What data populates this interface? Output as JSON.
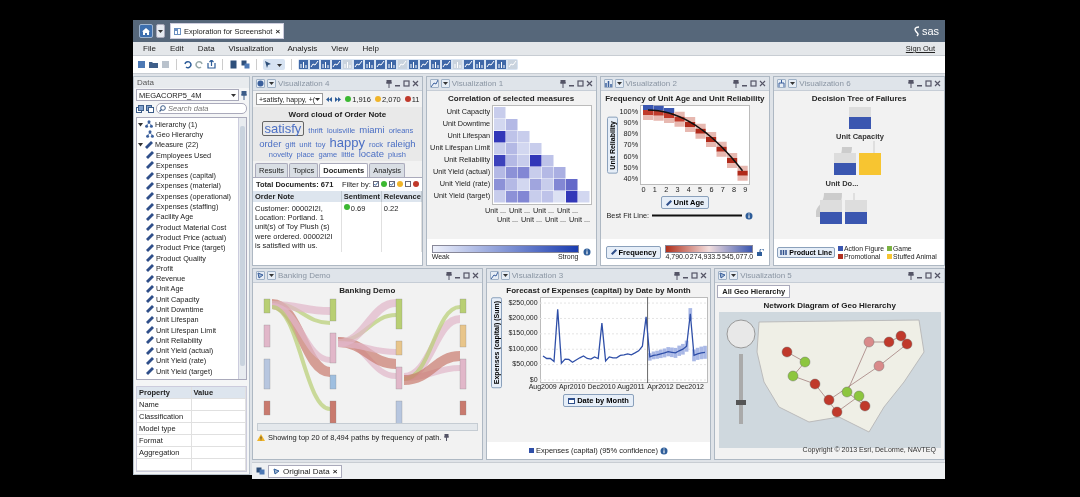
{
  "window": {
    "document_tab": "Exploration for Screenshot",
    "tab_close": "×",
    "logo": "sas"
  },
  "menu": [
    "File",
    "Edit",
    "Data",
    "Visualization",
    "Analysis",
    "View",
    "Help"
  ],
  "sign_out": "Sign Out",
  "data_panel": {
    "title": "Data",
    "source": "MEGACORP5_4M",
    "search_placeholder": "Search data",
    "tree": [
      {
        "label": "Hierarchy (1)",
        "kind": "hierarchy",
        "expanded": true,
        "children": [
          {
            "label": "Geo Hierarchy",
            "kind": "hierarchy"
          }
        ]
      },
      {
        "label": "Measure (22)",
        "kind": "measure",
        "expanded": true,
        "children": [
          {
            "label": "Employees Used",
            "kind": "measure"
          },
          {
            "label": "Expenses",
            "kind": "measure"
          },
          {
            "label": "Expenses (capital)",
            "kind": "measure"
          },
          {
            "label": "Expenses (material)",
            "kind": "measure"
          },
          {
            "label": "Expenses (operational)",
            "kind": "measure"
          },
          {
            "label": "Expenses (staffing)",
            "kind": "measure"
          },
          {
            "label": "Facility Age",
            "kind": "measure"
          },
          {
            "label": "Product Material Cost",
            "kind": "measure"
          },
          {
            "label": "Product Price (actual)",
            "kind": "measure"
          },
          {
            "label": "Product Price (target)",
            "kind": "measure"
          },
          {
            "label": "Product Quality",
            "kind": "measure"
          },
          {
            "label": "Profit",
            "kind": "measure"
          },
          {
            "label": "Revenue",
            "kind": "measure"
          },
          {
            "label": "Unit Age",
            "kind": "measure"
          },
          {
            "label": "Unit Capacity",
            "kind": "measure"
          },
          {
            "label": "Unit Downtime",
            "kind": "measure"
          },
          {
            "label": "Unit Lifespan",
            "kind": "measure"
          },
          {
            "label": "Unit Lifespan Limit",
            "kind": "measure"
          },
          {
            "label": "Unit Reliability",
            "kind": "measure"
          },
          {
            "label": "Unit Yield (actual)",
            "kind": "measure"
          },
          {
            "label": "Unit Yield (rate)",
            "kind": "measure"
          },
          {
            "label": "Unit Yield (target)",
            "kind": "measure"
          }
        ]
      }
    ],
    "properties": {
      "columns": [
        "Property",
        "Value"
      ],
      "rows": [
        "Name",
        "Classification",
        "Model type",
        "Format",
        "Aggregation"
      ]
    }
  },
  "viz4": {
    "title": "Visualization 4",
    "filter": "+satisfy, happy, +(",
    "counts": [
      {
        "value": "1,916",
        "color": "#3cb832"
      },
      {
        "value": "2,070",
        "color": "#f0b429"
      },
      {
        "value": "11",
        "color": "#c0392b"
      }
    ],
    "cloud_title": "Word cloud of Order Note",
    "words": [
      {
        "text": "satisfy",
        "kind": "large",
        "selected": true
      },
      {
        "text": "thrift",
        "kind": "small",
        "selected": false
      },
      {
        "text": "louisville",
        "kind": "small",
        "selected": false
      },
      {
        "text": "miami",
        "kind": "medium",
        "selected": false
      },
      {
        "text": "orleans",
        "kind": "small",
        "selected": false
      },
      {
        "text": "order",
        "kind": "medium",
        "selected": false
      },
      {
        "text": "gift",
        "kind": "small",
        "selected": false
      },
      {
        "text": "unit",
        "kind": "small",
        "selected": false
      },
      {
        "text": "toy",
        "kind": "small",
        "selected": false
      },
      {
        "text": "happy",
        "kind": "large",
        "selected": false
      },
      {
        "text": "rock",
        "kind": "small",
        "selected": false
      },
      {
        "text": "raleigh",
        "kind": "medium",
        "selected": false
      },
      {
        "text": "novelty",
        "kind": "small",
        "selected": false
      },
      {
        "text": "place",
        "kind": "small",
        "selected": false
      },
      {
        "text": "game",
        "kind": "small",
        "selected": false
      },
      {
        "text": "little",
        "kind": "small",
        "selected": false
      },
      {
        "text": "locate",
        "kind": "medium",
        "selected": false
      },
      {
        "text": "plush",
        "kind": "small",
        "selected": false
      }
    ],
    "tabs": [
      {
        "label": "Results",
        "selected": false
      },
      {
        "label": "Topics",
        "selected": false
      },
      {
        "label": "Documents",
        "selected": true
      },
      {
        "label": "Analysis",
        "selected": false
      }
    ],
    "total": "Total Documents: 671",
    "filter_label": "Filter by:",
    "filters": [
      {
        "checked": true,
        "color": "#3cb832"
      },
      {
        "checked": true,
        "color": "#f0b429"
      },
      {
        "checked": false,
        "color": "#c0392b"
      }
    ],
    "table": {
      "columns": [
        "Order Note",
        "Sentiment",
        "Relevance"
      ],
      "rows": [
        {
          "note": "Customer: 00002I2I, Location: Portland. 1 unit(s) of Toy Plush (s) were ordered. 00002I2I is satisfied with us.",
          "sentiment": "0.69",
          "color": "#3cb832",
          "relevance": "0.22"
        }
      ]
    }
  },
  "viz1": {
    "title": "Visualization 1",
    "chart_title": "Correlation of selected measures",
    "row_labels": [
      "Unit Capacity",
      "Unit Downtime",
      "Unit Lifespan",
      "Unit Lifespan Limit",
      "Unit Reliability",
      "Unit Yield (actual)",
      "Unit Yield (rate)",
      "Unit Yield (target)"
    ],
    "column_labels": [
      "Unit ...",
      "Unit ...",
      "Unit ...",
      "Unit ...",
      "Unit ...",
      "Unit ...",
      "Unit ...",
      "Unit ..."
    ],
    "legend": {
      "low": "Weak",
      "high": "Strong"
    }
  },
  "viz2": {
    "title": "Visualization 2",
    "chart_title": "Frequency of Unit Age and Unit Reliability",
    "y_ticks": [
      "100%",
      "90%",
      "80%",
      "70%",
      "60%",
      "50%",
      "40%"
    ],
    "x_ticks": [
      "0",
      "1",
      "2",
      "3",
      "4",
      "5",
      "6",
      "7",
      "8",
      "9"
    ],
    "y_role": "Unit Reliability",
    "x_role": "Unit Age",
    "fit_label": "Best Fit Line:",
    "color_role": "Frequency",
    "legend_ticks": [
      "4,790.0",
      "274,933.5",
      "545,077.0"
    ]
  },
  "viz6": {
    "title": "Visualization 6",
    "chart_title": "Decision Tree of Failures",
    "node_labels": [
      "Unit Capacity",
      "Unit Do..."
    ],
    "role": "Product Line",
    "legend": [
      {
        "label": "Action Figure",
        "color": "#3a56b0"
      },
      {
        "label": "Game",
        "color": "#7cb342"
      },
      {
        "label": "Promotional",
        "color": "#b03020"
      },
      {
        "label": "Stuffed Animal",
        "color": "#f7c531"
      }
    ]
  },
  "banking": {
    "title": "Banking Demo",
    "chart_title": "Banking Demo",
    "note": "Showing top 20 of 8,494 paths by frequency of path."
  },
  "viz3": {
    "title": "Visualization 3",
    "legend_suffix": "(95% confidence)",
    "chart_data": {
      "type": "line",
      "title": "Forecast of Expenses (capital) by Date by Month",
      "xlabel": "Date by Month",
      "ylabel": "Expenses (capital) (Sum)",
      "categories": [
        "Aug2009",
        null,
        null,
        null,
        null,
        null,
        null,
        null,
        "Apr2010",
        null,
        null,
        null,
        null,
        null,
        null,
        null,
        "Dec2010",
        null,
        null,
        null,
        null,
        null,
        null,
        null,
        "Aug2011",
        null,
        null,
        null,
        null,
        null,
        null,
        null,
        "Apr2012",
        null,
        null,
        null,
        null,
        null,
        null,
        null,
        "Dec2012",
        null,
        null,
        null,
        null
      ],
      "series": [
        {
          "name": "Expenses (capital)",
          "color": "#2f4fa8",
          "values": [
            78000,
            70000,
            70000,
            60000,
            230000,
            55000,
            68000,
            67000,
            58000,
            65000,
            72000,
            78000,
            70000,
            68000,
            75000,
            70000,
            185000,
            62000,
            75000,
            72000,
            72000,
            80000,
            82000,
            85000,
            82000,
            88000,
            95000,
            110000,
            205000,
            75000,
            80000,
            82000,
            85000,
            88000,
            92000,
            90000,
            88000,
            95000,
            100000,
            110000,
            215000,
            80000,
            85000,
            88000,
            90000
          ],
          "errors": [
            null,
            null,
            null,
            null,
            null,
            null,
            null,
            null,
            null,
            null,
            null,
            null,
            null,
            null,
            null,
            null,
            null,
            null,
            null,
            null,
            null,
            null,
            null,
            null,
            null,
            null,
            null,
            null,
            null,
            12000,
            12600,
            13200,
            13800,
            14400,
            15000,
            15600,
            16200,
            16800,
            17400,
            18000,
            18600,
            19200,
            19800,
            20400,
            21000
          ]
        }
      ],
      "ylim": [
        0,
        260000
      ],
      "grid": true,
      "yticks": [
        {
          "value": 0,
          "label": "$0"
        },
        {
          "value": 50000,
          "label": "$50,000"
        },
        {
          "value": 100000,
          "label": "$100,000"
        },
        {
          "value": 150000,
          "label": "$150,000"
        },
        {
          "value": 200000,
          "label": "$200,000"
        },
        {
          "value": 250000,
          "label": "$250,000"
        }
      ]
    }
  },
  "viz5": {
    "title": "Visualization 5",
    "tab": "All Geo Hierarchy",
    "chart_title": "Network Diagram of Geo Hierarchy",
    "copyright": "Copyright © 2013 Esri, DeLorme, NAVTEQ"
  },
  "bottom_tabs": [
    {
      "label": "Original Data",
      "selected": true,
      "close": "×"
    }
  ]
}
